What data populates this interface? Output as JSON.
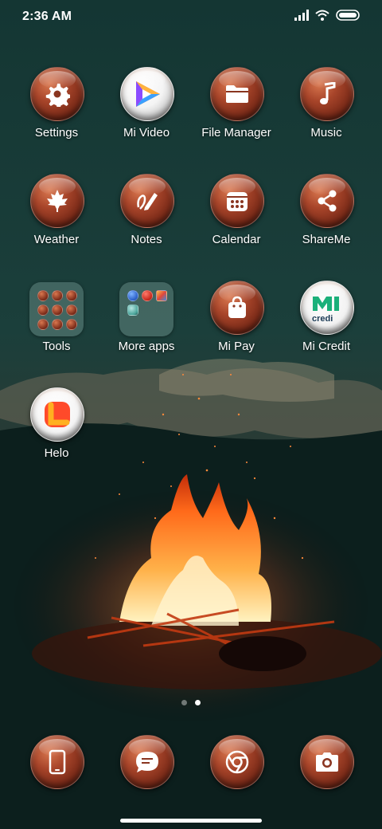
{
  "status_bar": {
    "time": "2:36 AM",
    "icons": [
      "signal-icon",
      "wifi-icon",
      "battery-icon"
    ]
  },
  "apps": [
    {
      "label": "Settings",
      "icon": "gear-icon"
    },
    {
      "label": "Mi Video",
      "icon": "mi-video-icon"
    },
    {
      "label": "File Manager",
      "icon": "folder-icon"
    },
    {
      "label": "Music",
      "icon": "music-note-icon"
    },
    {
      "label": "Weather",
      "icon": "maple-leaf-icon"
    },
    {
      "label": "Notes",
      "icon": "pen-note-icon"
    },
    {
      "label": "Calendar",
      "icon": "calendar-icon"
    },
    {
      "label": "ShareMe",
      "icon": "share-icon"
    },
    {
      "label": "Tools",
      "icon": "folder-tools-icon"
    },
    {
      "label": "More apps",
      "icon": "folder-more-apps-icon"
    },
    {
      "label": "Mi Pay",
      "icon": "shopping-bag-icon"
    },
    {
      "label": "Mi Credit",
      "icon": "mi-credit-icon"
    },
    {
      "label": "Helo",
      "icon": "helo-icon"
    }
  ],
  "pager": {
    "pages": 2,
    "active": 2
  },
  "dock": [
    {
      "icon": "phone-icon"
    },
    {
      "icon": "message-icon"
    },
    {
      "icon": "chrome-icon"
    },
    {
      "icon": "camera-icon"
    }
  ],
  "colors": {
    "wallpaper_dark": "#0f2c2b",
    "icon_brown": "#a8452a",
    "fire_orange": "#ff7a1a"
  }
}
